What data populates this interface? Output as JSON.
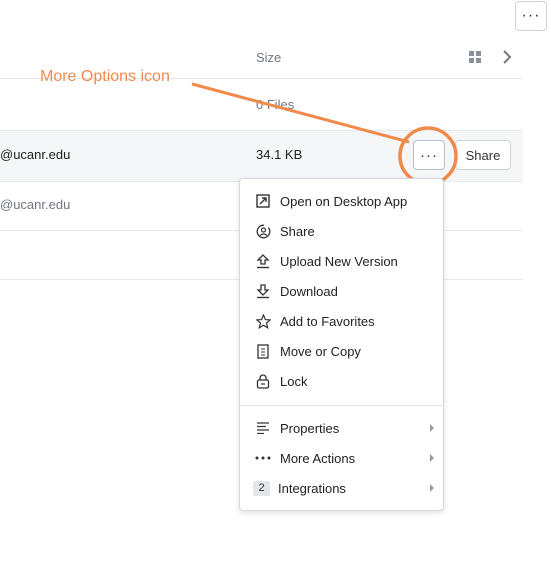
{
  "toolbar": {
    "more_icon": "more-horizontal-icon",
    "more_text": "···"
  },
  "table": {
    "size_header": "Size",
    "rows": [
      {
        "owner": "",
        "size": "0 Files"
      },
      {
        "owner": "@ucanr.edu",
        "size": "34.1 KB"
      },
      {
        "owner": "@ucanr.edu",
        "size": ""
      }
    ],
    "share_label": "Share",
    "row_more_text": "···"
  },
  "annotation": {
    "label": "More Options icon",
    "color": "#f08a4b"
  },
  "menu": {
    "items": [
      {
        "label": "Open on Desktop App",
        "icon": "external-open-icon"
      },
      {
        "label": "Share",
        "icon": "share-people-icon"
      },
      {
        "label": "Upload New Version",
        "icon": "upload-icon"
      },
      {
        "label": "Download",
        "icon": "download-icon"
      },
      {
        "label": "Add to Favorites",
        "icon": "star-icon"
      },
      {
        "label": "Move or Copy",
        "icon": "copy-icon"
      },
      {
        "label": "Lock",
        "icon": "lock-icon"
      }
    ],
    "submenus": [
      {
        "label": "Properties",
        "icon": "properties-icon"
      },
      {
        "label": "More Actions",
        "icon": "more-actions-icon"
      },
      {
        "label": "Integrations",
        "badge": "2"
      }
    ]
  }
}
